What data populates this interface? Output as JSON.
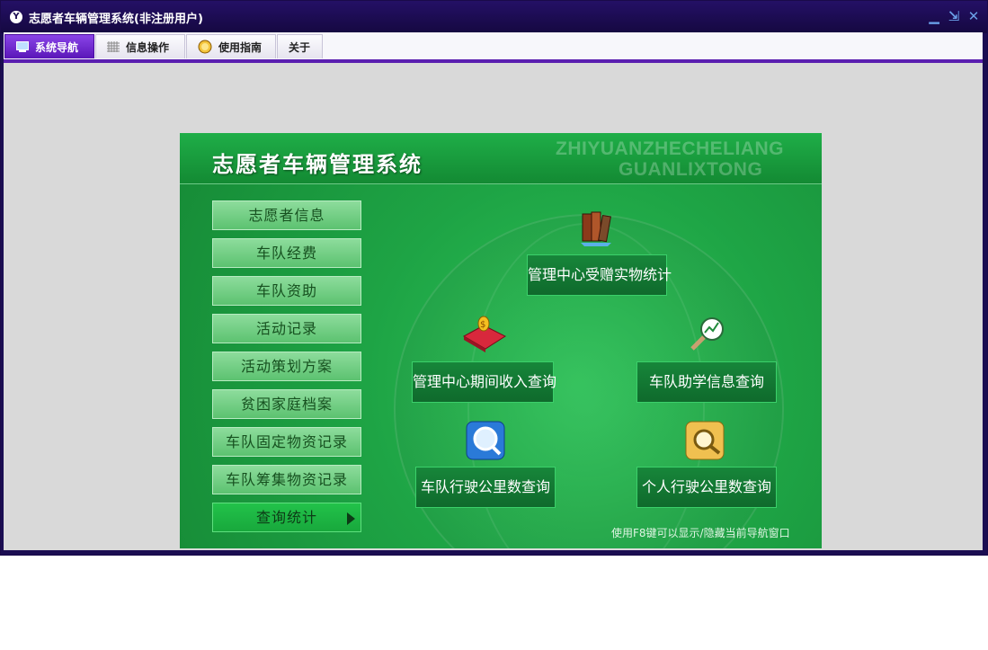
{
  "window": {
    "title": "志愿者车辆管理系统(非注册用户)",
    "logo_letter": "Y"
  },
  "window_controls": {
    "minimize": "▁",
    "restore": "⇲",
    "close": "✕"
  },
  "menu": {
    "tabs": [
      {
        "label": "系统导航",
        "icon": "monitor-icon",
        "active": true
      },
      {
        "label": "信息操作",
        "icon": "grid-icon",
        "active": false
      },
      {
        "label": "使用指南",
        "icon": "compass-icon",
        "active": false
      },
      {
        "label": "关于",
        "icon": "",
        "active": false
      }
    ]
  },
  "panel": {
    "title": "志愿者车辆管理系统",
    "watermark_line1": "ZHIYUANZHECHELIANG",
    "watermark_line2": "GUANLIXTONG",
    "sidebar": [
      "志愿者信息",
      "车队经费",
      "车队资助",
      "活动记录",
      "活动策划方案",
      "贫困家庭档案",
      "车队固定物资记录",
      "车队筹集物资记录",
      "查询统计"
    ],
    "active_sidebar_item": "查询统计",
    "queries": [
      {
        "label": "管理中心受赠实物统计",
        "icon": "books-icon"
      },
      {
        "label": "管理中心期间收入查询",
        "icon": "money-bag-icon"
      },
      {
        "label": "车队助学信息查询",
        "icon": "magnifier-chart-icon"
      },
      {
        "label": "车队行驶公里数查询",
        "icon": "search-window-icon"
      },
      {
        "label": "个人行驶公里数查询",
        "icon": "folder-search-icon"
      }
    ],
    "hint": "使用F8键可以显示/隐藏当前导航窗口"
  },
  "colors": {
    "accent": "#5a1fb0",
    "titlebar": "#1b0d52",
    "panel_green": "#1ea445"
  }
}
